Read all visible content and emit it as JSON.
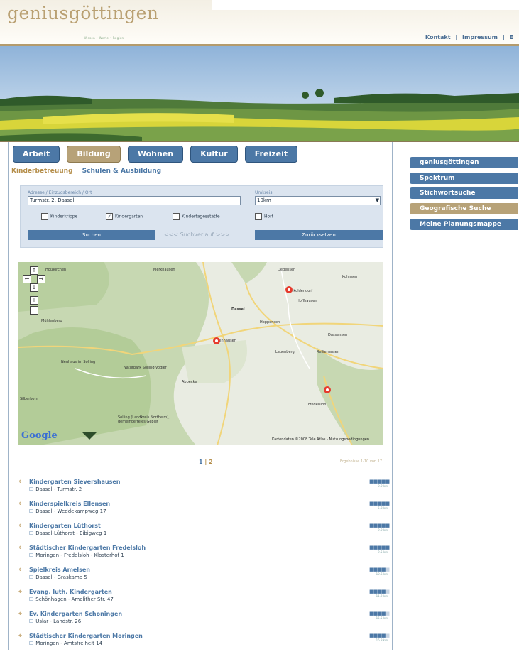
{
  "header": {
    "logo": "geniusgöttingen",
    "tagline": "Wissen • Werte • Region",
    "links": [
      "Kontakt",
      "|",
      "Impressum",
      "|",
      "E"
    ]
  },
  "tabs": [
    {
      "label": "Arbeit",
      "active": false
    },
    {
      "label": "Bildung",
      "active": true
    },
    {
      "label": "Wohnen",
      "active": false
    },
    {
      "label": "Kultur",
      "active": false
    },
    {
      "label": "Freizeit",
      "active": false
    }
  ],
  "subtabs": [
    {
      "label": "Kinderbetreuung",
      "active": true
    },
    {
      "label": "Schulen & Ausbildung",
      "active": false
    }
  ],
  "search": {
    "address_label": "Adresse / Einzugsbereich / Ort",
    "address_value": "Turmstr. 2, Dassel",
    "radius_label": "Umkreis",
    "radius_value": "10km",
    "checkboxes": [
      {
        "label": "Kinderkrippe",
        "checked": false
      },
      {
        "label": "Kindergarten",
        "checked": true
      },
      {
        "label": "Kindertagesstätte",
        "checked": false
      },
      {
        "label": "Hort",
        "checked": false
      }
    ],
    "search_button": "Suchen",
    "pager_text": "<<< Suchverlauf >>>",
    "reset_button": "Zurücksetzen"
  },
  "map": {
    "places": [
      "Holzkirchen",
      "Merxhausen",
      "Dedensen",
      "Kohnsen",
      "Markoldendorf",
      "Hoffhausen",
      "Dassel",
      "Hoppensen",
      "Dassensen",
      "Rellinhausen",
      "Lauenberg",
      "Relliehausen",
      "Mühlenberg",
      "Neuhaus im Solling",
      "Naturpark Solling-Vogler",
      "Abbecke",
      "Fredelsloh",
      "Silberborn",
      "Solling (Landkreis Northeim), gemeindefreies Gebiet"
    ],
    "copyright": "Kartendaten ©2008 Tele Atlas - Nutzungsbedingungen",
    "provider": "Google"
  },
  "pagination": {
    "pages": [
      "1",
      "|",
      "2"
    ],
    "results_info": "Ergebnisse 1-10 von 17"
  },
  "results": [
    {
      "title": "Kindergarten Sievershausen",
      "address": "Dassel - Turmstr. 2",
      "distance": "0.0 km",
      "rating": 5
    },
    {
      "title": "Kinderspielkreis Ellensen",
      "address": "Dassel - Weddekampweg 17",
      "distance": "5.8 km",
      "rating": 5
    },
    {
      "title": "Kindergarten Lüthorst",
      "address": "Dassel-Lüthorst - Eibigweg 1",
      "distance": "9.0 km",
      "rating": 5
    },
    {
      "title": "Städtischer Kindergarten Fredelsloh",
      "address": "Moringen - Fredelsloh - Klosterhof 1",
      "distance": "9.5 km",
      "rating": 5
    },
    {
      "title": "Spielkreis Amelsen",
      "address": "Dassel - Graskamp 5",
      "distance": "10.6 km",
      "rating": 4
    },
    {
      "title": "Evang. luth. Kindergarten",
      "address": "Schönhagen - Amelither Str. 47",
      "distance": "11.2 km",
      "rating": 4
    },
    {
      "title": "Ev. Kindergarten Schoningen",
      "address": "Uslar - Landstr. 26",
      "distance": "15.5 km",
      "rating": 4
    },
    {
      "title": "Städtischer Kindergarten Moringen",
      "address": "Moringen - Amtsfreiheit 14",
      "distance": "16.8 km",
      "rating": 4
    }
  ],
  "sidebar": [
    {
      "label": "geniusgöttingen",
      "active": false
    },
    {
      "label": "Spektrum",
      "active": false
    },
    {
      "label": "Stichwortsuche",
      "active": false
    },
    {
      "label": "Geografische Suche",
      "active": true
    },
    {
      "label": "Meine Planungsmappe",
      "active": false
    }
  ],
  "colors": {
    "accent_blue": "#4c78a6",
    "accent_gold": "#b7a278"
  }
}
